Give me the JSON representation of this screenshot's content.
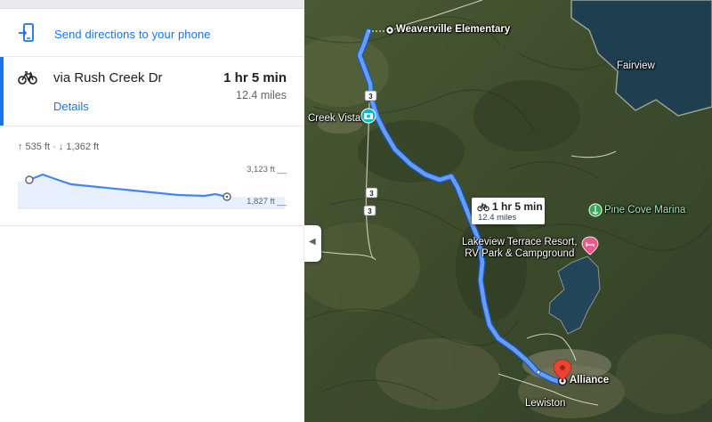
{
  "panel": {
    "send_label": "Send directions to your phone",
    "route": {
      "via": "via Rush Creek Dr",
      "duration": "1 hr 5 min",
      "distance": "12.4 miles",
      "details_label": "Details"
    },
    "elevation": {
      "summary": "↑ 535 ft · ↓ 1,362 ft",
      "max_label": "3,123 ft __",
      "min_label": "1,827 ft __"
    }
  },
  "map": {
    "origin": "Weaverville Elementary",
    "destination": "Alliance",
    "bubble": {
      "duration": "1 hr 5 min",
      "distance": "12.4 miles"
    },
    "places": {
      "fairview": "Fairview",
      "creek_vista": "Creek Vista",
      "pine_cove": "Pine Cove Marina",
      "lakeview_line1": "Lakeview Terrace Resort,",
      "lakeview_line2": "RV Park & Campground",
      "lewiston": "Lewiston"
    },
    "road_shield": "3",
    "collapse_icon": "chevron-left-icon"
  },
  "colors": {
    "accent": "#1a73e8",
    "route": "#669df6",
    "route_border": "#1a56c7",
    "pin": "#ea4335",
    "park": "#34a853",
    "lodging": "#e8598c"
  }
}
